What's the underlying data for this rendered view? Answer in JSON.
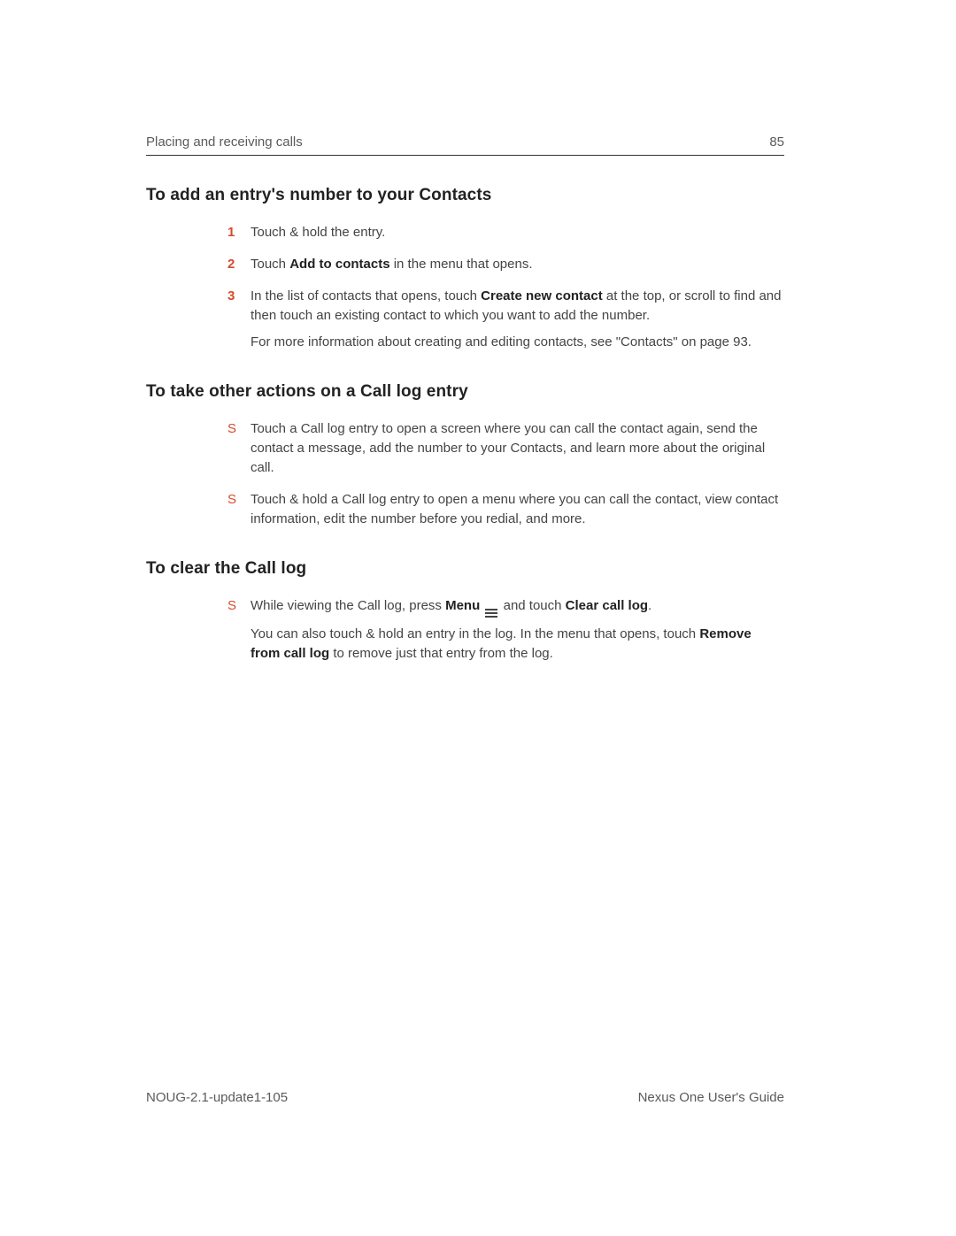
{
  "header": {
    "section": "Placing and receiving calls",
    "page_number": "85"
  },
  "sections": [
    {
      "title": "To add an entry's number to your Contacts",
      "marker_type": "number",
      "items": [
        {
          "marker": "1",
          "paras": [
            [
              {
                "t": "Touch & hold the entry."
              }
            ]
          ]
        },
        {
          "marker": "2",
          "paras": [
            [
              {
                "t": "Touch "
              },
              {
                "t": "Add to contacts",
                "b": true
              },
              {
                "t": " in the menu that opens."
              }
            ]
          ]
        },
        {
          "marker": "3",
          "paras": [
            [
              {
                "t": "In the list of contacts that opens, touch "
              },
              {
                "t": "Create new contact",
                "b": true
              },
              {
                "t": " at the top, or scroll to find and then touch an existing contact to which you want to add the number."
              }
            ],
            [
              {
                "t": "For more information about creating and editing contacts, see \"Contacts\" on page 93."
              }
            ]
          ]
        }
      ]
    },
    {
      "title": "To take other actions on a Call log entry",
      "marker_type": "bullet",
      "items": [
        {
          "marker": "S",
          "paras": [
            [
              {
                "t": "Touch a Call log entry to open a screen where you can call the contact again, send the contact a message, add the number to your Contacts, and learn more about the original call."
              }
            ]
          ]
        },
        {
          "marker": "S",
          "paras": [
            [
              {
                "t": "Touch & hold a Call log entry to open a menu where you can call the contact, view contact information, edit the number before you redial, and more."
              }
            ]
          ]
        }
      ]
    },
    {
      "title": "To clear the Call log",
      "marker_type": "bullet",
      "items": [
        {
          "marker": "S",
          "paras": [
            [
              {
                "t": "While viewing the Call log, press "
              },
              {
                "t": "Menu",
                "b": true
              },
              {
                "t": " "
              },
              {
                "icon": "menu"
              },
              {
                "t": " and touch "
              },
              {
                "t": "Clear call log",
                "b": true
              },
              {
                "t": "."
              }
            ],
            [
              {
                "t": "You can also touch & hold an entry in the log. In the menu that opens, touch "
              },
              {
                "t": "Remove from call log",
                "b": true
              },
              {
                "t": " to remove just that entry from the log."
              }
            ]
          ]
        }
      ]
    }
  ],
  "footer": {
    "left": "NOUG-2.1-update1-105",
    "right": "Nexus One User's Guide"
  }
}
